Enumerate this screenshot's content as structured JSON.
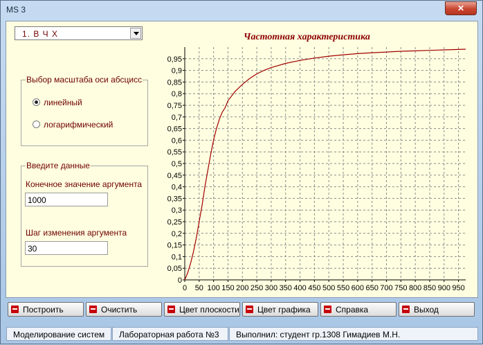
{
  "window": {
    "title": "MS 3",
    "close_glyph": "✕"
  },
  "controls": {
    "mode_select_value": "1. В Ч Х",
    "scale_group_label": "Выбор масштаба оси абсцисс",
    "radio_linear": "линейный",
    "radio_log": "логарифмический",
    "selected_scale": "linear",
    "input_group_label": "Введите данные",
    "end_value_label": "Конечное значение аргумента",
    "end_value": "1000",
    "step_label": "Шаг изменения аргумента",
    "step_value": "30"
  },
  "buttons": {
    "build": "Построить",
    "clear": "Очистить",
    "plane_color": "Цвет плоскости",
    "graph_color": "Цвет графика",
    "help": "Справка",
    "exit": "Выход"
  },
  "statusbar": {
    "left": "Моделирование систем",
    "middle": "Лабораторная работа №3",
    "right": "Выполнил: студент гр.1308 Гимадиев М.Н."
  },
  "colors": {
    "curve": "#a00000",
    "plot_bg": "#fffee0",
    "accent_text": "#700000"
  },
  "chart_data": {
    "type": "line",
    "title": "Частотная характеристика",
    "xlim": [
      0,
      975
    ],
    "ylim": [
      0,
      1
    ],
    "x_ticks": [
      0,
      50,
      100,
      150,
      200,
      250,
      300,
      350,
      400,
      450,
      500,
      550,
      600,
      650,
      700,
      750,
      800,
      850,
      900,
      950
    ],
    "y_ticks": [
      "0",
      "0,05",
      "0,1",
      "0,15",
      "0,2",
      "0,25",
      "0,3",
      "0,35",
      "0,4",
      "0,45",
      "0,5",
      "0,55",
      "0,6",
      "0,65",
      "0,7",
      "0,75",
      "0,8",
      "0,85",
      "0,9",
      "0,95"
    ],
    "grid": true,
    "series": [
      {
        "x": [
          0,
          10,
          20,
          30,
          40,
          50,
          60,
          70,
          80,
          90,
          100,
          110,
          120,
          130,
          140,
          150,
          175,
          200,
          225,
          250,
          275,
          300,
          350,
          400,
          450,
          500,
          550,
          600,
          650,
          700,
          750,
          800,
          850,
          900,
          950,
          975
        ],
        "y": [
          0,
          0.03,
          0.07,
          0.12,
          0.18,
          0.25,
          0.32,
          0.4,
          0.47,
          0.54,
          0.6,
          0.65,
          0.69,
          0.72,
          0.74,
          0.77,
          0.81,
          0.84,
          0.865,
          0.885,
          0.9,
          0.912,
          0.93,
          0.943,
          0.953,
          0.961,
          0.967,
          0.972,
          0.976,
          0.979,
          0.982,
          0.984,
          0.986,
          0.988,
          0.99,
          0.991
        ]
      }
    ]
  }
}
